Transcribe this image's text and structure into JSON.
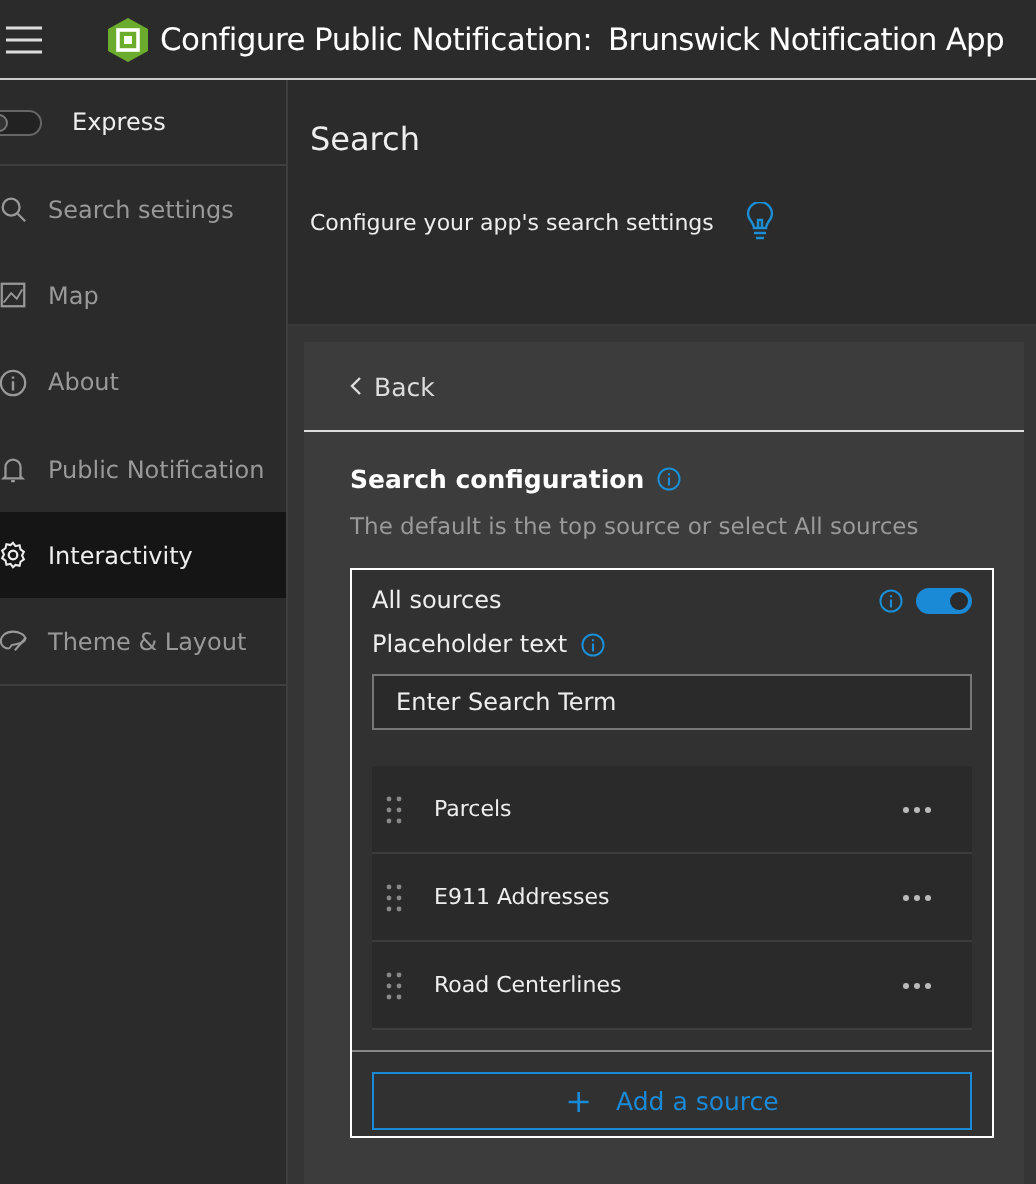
{
  "header": {
    "title": "Configure Public Notification:",
    "app_name": "Brunswick Notification App"
  },
  "express": {
    "label": "Express",
    "on": false
  },
  "nav": [
    {
      "label": "Search settings",
      "selected": false,
      "kind": "search"
    },
    {
      "label": "Map",
      "selected": false,
      "kind": "map"
    },
    {
      "label": "About",
      "selected": false,
      "kind": "info"
    },
    {
      "label": "Public Notification",
      "selected": false,
      "kind": "bell"
    },
    {
      "label": "Interactivity",
      "selected": true,
      "kind": "gear"
    },
    {
      "label": "Theme & Layout",
      "selected": false,
      "kind": "palette"
    }
  ],
  "section": {
    "title": "Search",
    "description": "Configure your app's search settings"
  },
  "panel": {
    "back": "Back",
    "heading": "Search configuration",
    "hint": "The default is the top source or select All sources",
    "all_sources": {
      "label": "All sources",
      "on": true
    },
    "placeholder_label": "Placeholder text",
    "placeholder_field": {
      "value": "Enter Search Term"
    },
    "sources": [
      {
        "name": "Parcels"
      },
      {
        "name": "E911 Addresses"
      },
      {
        "name": "Road Centerlines"
      }
    ],
    "add_button": "Add a source",
    "add_icon": "+"
  }
}
